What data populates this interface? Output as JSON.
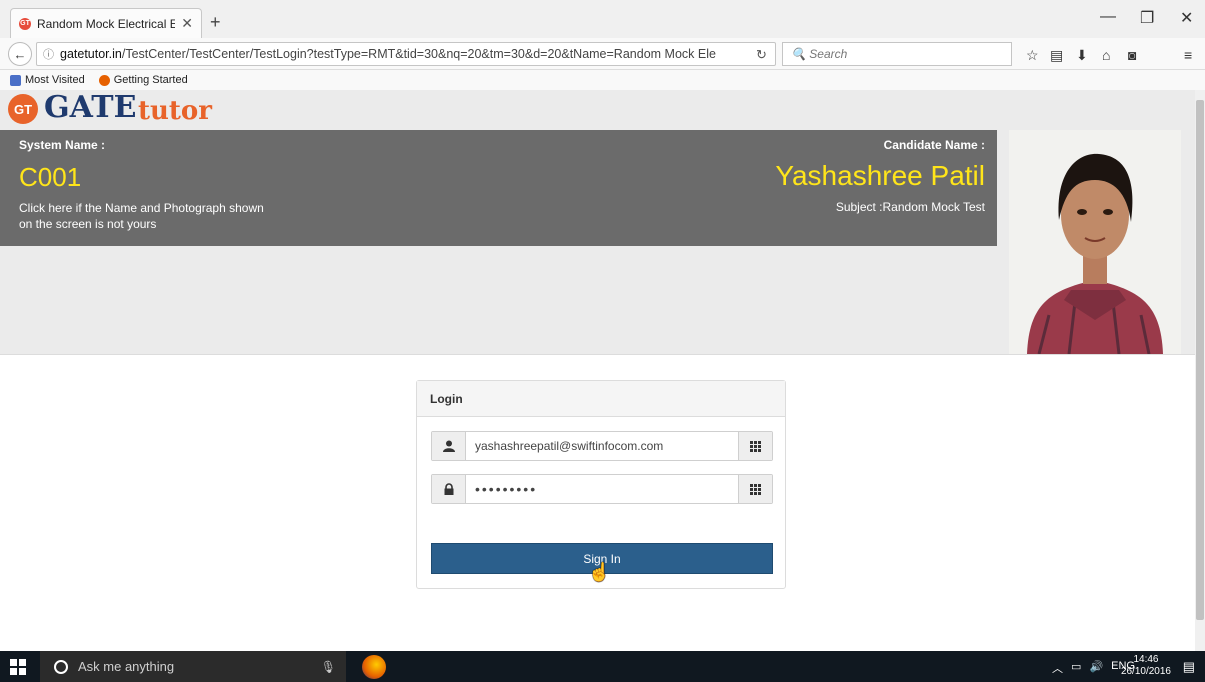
{
  "browser": {
    "tab_title": "Random Mock Electrical E...",
    "tab_close": "✕",
    "new_tab": "+",
    "url_domain": "gatetutor.in",
    "url_path": "/TestCenter/TestCenter/TestLogin?testType=RMT&tid=30&nq=20&tm=30&d=20&tName=Random Mock Ele",
    "search_placeholder": "Search",
    "bookmarks": [
      "Most Visited",
      "Getting Started"
    ]
  },
  "logo": {
    "badge": "GT",
    "gate": "GATE",
    "tutor": "tutor"
  },
  "header": {
    "system_label": "System Name :",
    "system_value": "C001",
    "note": "Click here if the Name and Photograph shown on the screen is not yours",
    "candidate_label": "Candidate Name :",
    "candidate_value": "Yashashree Patil",
    "subject": "Subject :Random Mock Test"
  },
  "login": {
    "heading": "Login",
    "username": "yashashreepatil@swiftinfocom.com",
    "password": "•••••••••",
    "signin_label": "Sign In"
  },
  "taskbar": {
    "search_placeholder": "Ask me anything",
    "lang": "ENG",
    "time": "14:46",
    "date": "26/10/2016"
  },
  "colors": {
    "accent": "#2b5f8c",
    "highlight": "#ffe51a",
    "panel": "#6b6b6b",
    "brand_orange": "#e8632a"
  }
}
